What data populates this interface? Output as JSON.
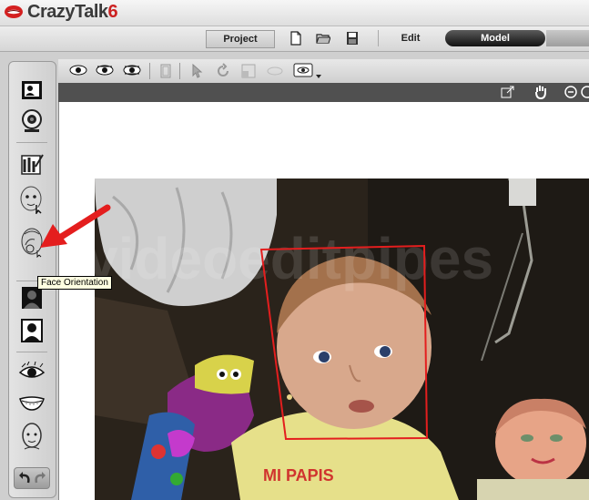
{
  "app": {
    "name": "CrazyTalk",
    "version": "6"
  },
  "modebar": {
    "project_label": "Project",
    "edit_label": "Edit",
    "model_label": "Model"
  },
  "tooltip": {
    "text": "Face Orientation"
  },
  "photo": {
    "watermark": "videoeditpipes",
    "shirt_text": "MI PAPIS"
  },
  "colors": {
    "accent_red": "#e41e1e",
    "model_tab_bg": "#1a1a1a",
    "viewport_bar": "#505050"
  }
}
